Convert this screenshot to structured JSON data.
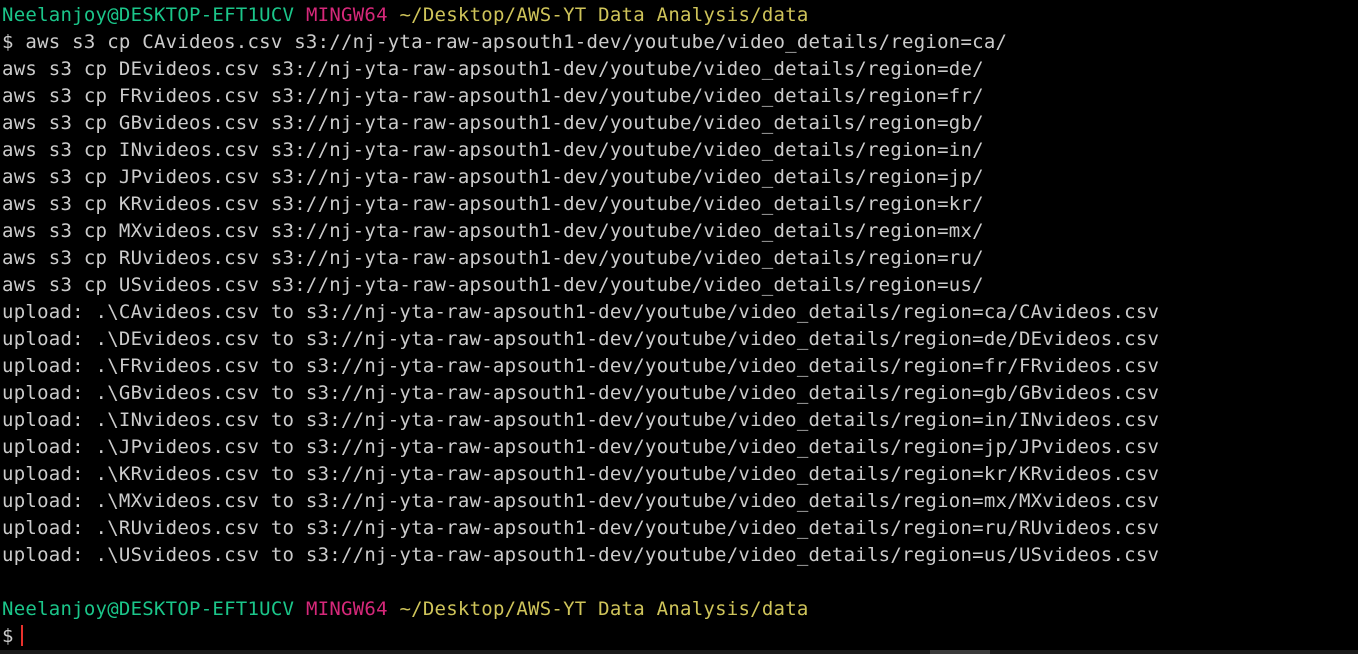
{
  "prompt": {
    "user_host": "Neelanjoy@DESKTOP-EFT1UCV",
    "env": "MINGW64",
    "cwd": "~/Desktop/AWS-YT Data Analysis/data",
    "symbol": "$"
  },
  "output_lines": [
    "$ aws s3 cp CAvideos.csv s3://nj-yta-raw-apsouth1-dev/youtube/video_details/region=ca/",
    "aws s3 cp DEvideos.csv s3://nj-yta-raw-apsouth1-dev/youtube/video_details/region=de/",
    "aws s3 cp FRvideos.csv s3://nj-yta-raw-apsouth1-dev/youtube/video_details/region=fr/",
    "aws s3 cp GBvideos.csv s3://nj-yta-raw-apsouth1-dev/youtube/video_details/region=gb/",
    "aws s3 cp INvideos.csv s3://nj-yta-raw-apsouth1-dev/youtube/video_details/region=in/",
    "aws s3 cp JPvideos.csv s3://nj-yta-raw-apsouth1-dev/youtube/video_details/region=jp/",
    "aws s3 cp KRvideos.csv s3://nj-yta-raw-apsouth1-dev/youtube/video_details/region=kr/",
    "aws s3 cp MXvideos.csv s3://nj-yta-raw-apsouth1-dev/youtube/video_details/region=mx/",
    "aws s3 cp RUvideos.csv s3://nj-yta-raw-apsouth1-dev/youtube/video_details/region=ru/",
    "aws s3 cp USvideos.csv s3://nj-yta-raw-apsouth1-dev/youtube/video_details/region=us/",
    "upload: .\\CAvideos.csv to s3://nj-yta-raw-apsouth1-dev/youtube/video_details/region=ca/CAvideos.csv",
    "upload: .\\DEvideos.csv to s3://nj-yta-raw-apsouth1-dev/youtube/video_details/region=de/DEvideos.csv",
    "upload: .\\FRvideos.csv to s3://nj-yta-raw-apsouth1-dev/youtube/video_details/region=fr/FRvideos.csv",
    "upload: .\\GBvideos.csv to s3://nj-yta-raw-apsouth1-dev/youtube/video_details/region=gb/GBvideos.csv",
    "upload: .\\INvideos.csv to s3://nj-yta-raw-apsouth1-dev/youtube/video_details/region=in/INvideos.csv",
    "upload: .\\JPvideos.csv to s3://nj-yta-raw-apsouth1-dev/youtube/video_details/region=jp/JPvideos.csv",
    "upload: .\\KRvideos.csv to s3://nj-yta-raw-apsouth1-dev/youtube/video_details/region=kr/KRvideos.csv",
    "upload: .\\MXvideos.csv to s3://nj-yta-raw-apsouth1-dev/youtube/video_details/region=mx/MXvideos.csv",
    "upload: .\\RUvideos.csv to s3://nj-yta-raw-apsouth1-dev/youtube/video_details/region=ru/RUvideos.csv",
    "upload: .\\USvideos.csv to s3://nj-yta-raw-apsouth1-dev/youtube/video_details/region=us/USvideos.csv"
  ],
  "colors": {
    "background": "#000000",
    "text": "#cccccc",
    "user_host": "#1bc68a",
    "env": "#d6287a",
    "path": "#cfc45a",
    "cursor": "#e8312c"
  }
}
